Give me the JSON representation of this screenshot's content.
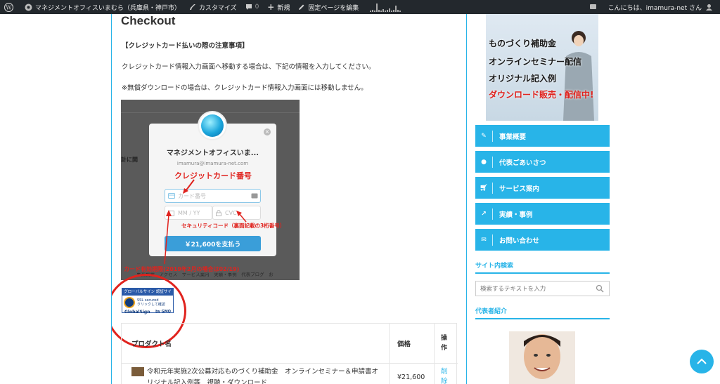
{
  "adminbar": {
    "site_name": "マネジメントオフィスいまむら（兵庫県・神戸市）",
    "customize": "カスタマイズ",
    "comments_count": "0",
    "new": "新規",
    "edit_page": "固定ページを編集",
    "greeting": "こんにちは、imamura-net さん"
  },
  "main": {
    "title": "Checkout",
    "notice_heading": "【クレジットカード払いの際の注意事項】",
    "notice_line1": "クレジットカード情報入力画面へ移動する場合は、下記の情報を入力してください。",
    "notice_line2": "※無償ダウンロードの場合は、クレジットカード情報入力画面には移動しません。"
  },
  "stripe_modal": {
    "merchant": "マネジメントオフィスいま...",
    "email": "imamura@imamura-net.com",
    "card_placeholder": "カード番号",
    "exp_placeholder": "MM / YY",
    "cvc_placeholder": "CVC",
    "pay_button": "￥21,600を支払う",
    "bg_snippet_left": "計に関",
    "bg_menu": "事業概要　アクセス　サービス案内　実績・事例　代表ブログ　お"
  },
  "annotations": {
    "card_number": "クレジットカード番号",
    "security_code": "セキュリティコード（裏面記載の3桁番号）",
    "expiry": "カード有効期限(2019年2月の場合は02/19)"
  },
  "ssl_badge": {
    "top": "グローバルサイン 認証サイト",
    "line1": "SSL secured",
    "line2": "クリックして確認",
    "brand": "GlobalSign",
    "by": "by GMO"
  },
  "table": {
    "col_product": "プロダクト名",
    "col_price": "価格",
    "col_action": "操作",
    "row_product": "令和元年実施2次公募対応ものづくり補助金　オンラインセミナー＆申請書オリジナル記入例等　視聴・ダウンロード",
    "row_price": "¥21,600",
    "row_action": "削除"
  },
  "sidebar": {
    "banner_line1": "ものづくり補助金",
    "banner_line2": "オンラインセミナー配信",
    "banner_line3": "オリジナル記入例",
    "banner_line4": "ダウンロード販売・配信中!",
    "nav": [
      {
        "label": "事業概要",
        "icon": "edit-icon"
      },
      {
        "label": "代表ごあいさつ",
        "icon": "user-icon"
      },
      {
        "label": "サービス案内",
        "icon": "cart-icon"
      },
      {
        "label": "実績・事例",
        "icon": "chart-icon"
      },
      {
        "label": "お問い合わせ",
        "icon": "mail-icon"
      }
    ],
    "search_heading": "サイト内検索",
    "search_placeholder": "検索するテキストを入力",
    "profile_heading": "代表者紹介"
  },
  "colors": {
    "accent": "#28b4e8",
    "admin_bar": "#23282d",
    "annotation_red": "#e0231e"
  }
}
